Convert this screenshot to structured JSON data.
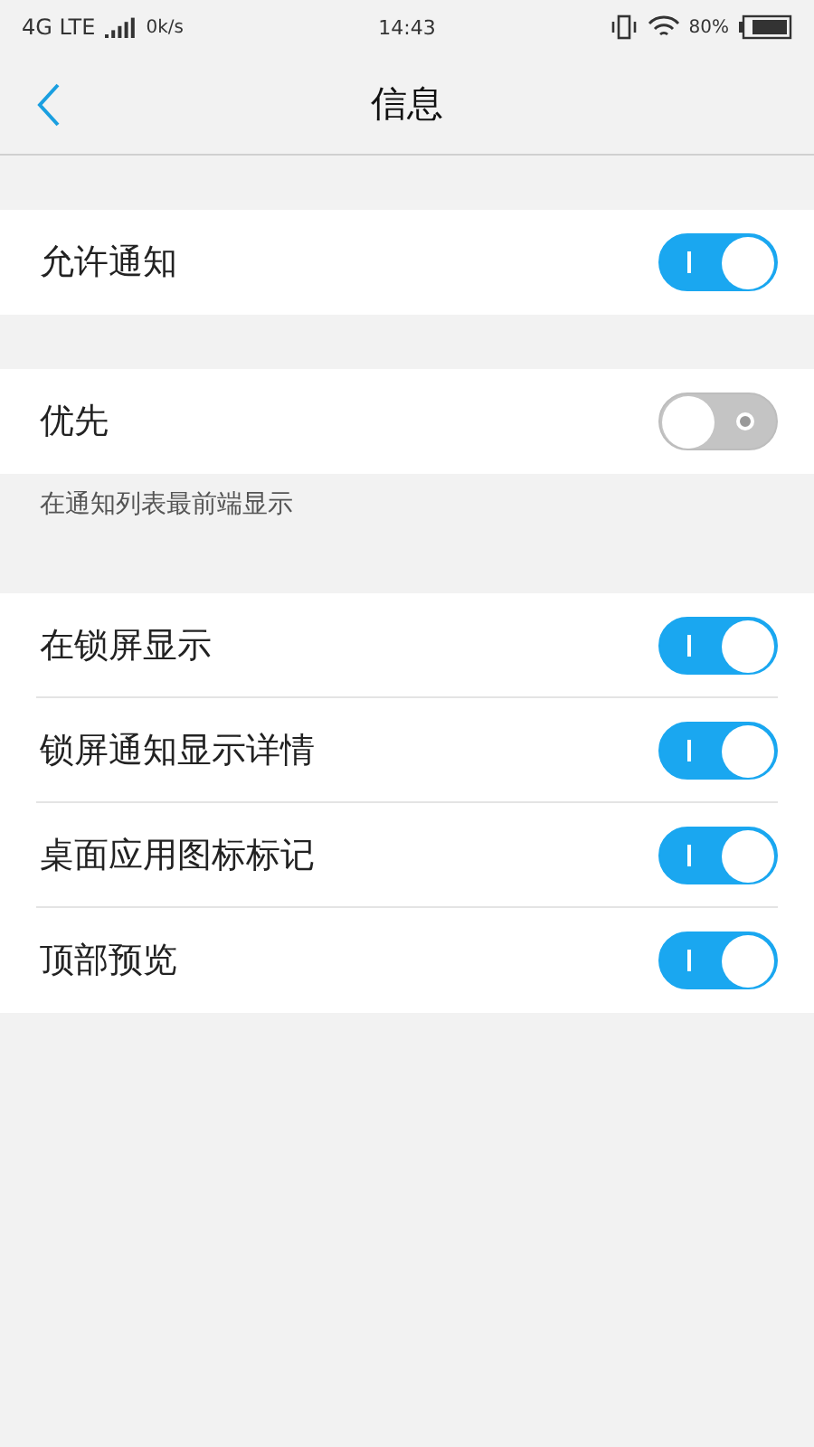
{
  "status_bar": {
    "network": "4G LTE",
    "speed": "0k/s",
    "time": "14:43",
    "battery": "80%"
  },
  "header": {
    "title": "信息"
  },
  "groups": [
    {
      "rows": [
        {
          "label": "允许通知",
          "on": true
        }
      ]
    },
    {
      "rows": [
        {
          "label": "优先",
          "on": false
        }
      ],
      "caption": "在通知列表最前端显示"
    },
    {
      "rows": [
        {
          "label": "在锁屏显示",
          "on": true
        },
        {
          "label": "锁屏通知显示详情",
          "on": true
        },
        {
          "label": "桌面应用图标标记",
          "on": true
        },
        {
          "label": "顶部预览",
          "on": true
        }
      ]
    }
  ]
}
